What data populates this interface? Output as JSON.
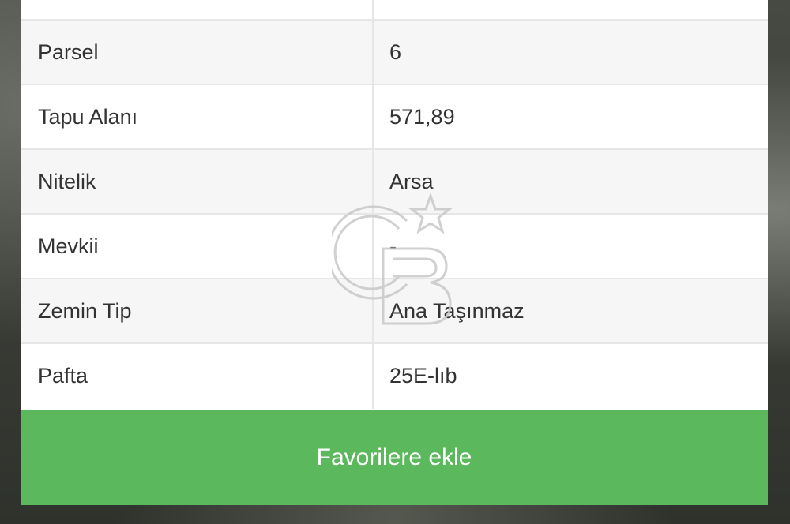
{
  "details": {
    "rows": [
      {
        "label": "",
        "value": ""
      },
      {
        "label": "Parsel",
        "value": "6"
      },
      {
        "label": "Tapu Alanı",
        "value": "571,89"
      },
      {
        "label": "Nitelik",
        "value": "Arsa"
      },
      {
        "label": "Mevkii",
        "value": "-"
      },
      {
        "label": "Zemin Tip",
        "value": "Ana Taşınmaz"
      },
      {
        "label": "Pafta",
        "value": "25E-lıb"
      }
    ]
  },
  "actions": {
    "favorite_label": "Favorilere ekle"
  },
  "colors": {
    "accent": "#5cb85c",
    "row_alt": "#f6f6f6",
    "border": "#e6e6e6",
    "text": "#333333"
  },
  "watermark": {
    "icon": "cb-star-logo-icon"
  }
}
